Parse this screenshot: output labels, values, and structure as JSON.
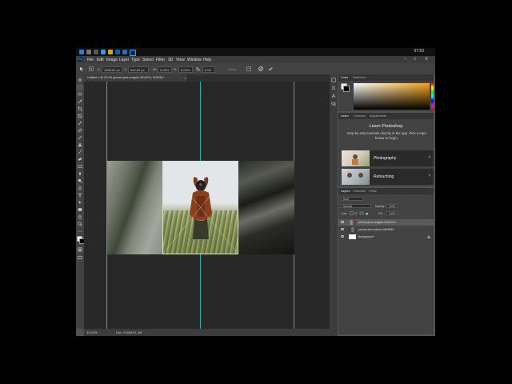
{
  "taskbar": {
    "time": "07:53"
  },
  "app": {
    "logo": "Ps"
  },
  "menu": [
    "File",
    "Edit",
    "Image",
    "Layer",
    "Type",
    "Select",
    "Filter",
    "3D",
    "View",
    "Window",
    "Help"
  ],
  "window_controls": {
    "minimize": "–",
    "maximize": "□",
    "close": "✕"
  },
  "options": {
    "x_value": "1055,00 px",
    "y_value": "540,00 px",
    "w_value": "0,00%",
    "h_value": "0,00%",
    "angle_value": "0,00",
    "x_label": "X:",
    "y_label": "Y:",
    "w_label": "W:",
    "h_label": "H:",
    "interp_label": "Interp"
  },
  "document_tab": {
    "title": "Untitled-1 @ 33,3% (pexels-jack-redgate-3014019, RGB/8) *",
    "close": "×"
  },
  "status": {
    "zoom": "33,33%",
    "doc": "Doc: 5,93M/11,1M"
  },
  "color_panel": {
    "tabs": [
      "Color",
      "Swatches"
    ],
    "accent": "#f5a21a"
  },
  "learn_panel": {
    "tabs": [
      "Learn",
      "Libraries",
      "Adjustments"
    ],
    "title": "Learn Photoshop",
    "subtitle": "Step-by-step tutorials directly in the app. Pick a topic below to begin.",
    "cards": [
      {
        "label": "Photography",
        "chevron": "›"
      },
      {
        "label": "Retouching",
        "chevron": "›"
      }
    ]
  },
  "layers_panel": {
    "tabs": [
      "Layers",
      "Channels",
      "Paths"
    ],
    "kind_label": "Kind",
    "blend_mode": "Normal",
    "opacity_label": "Opacity:",
    "opacity": "100%",
    "lock_label": "Lock:",
    "fill_label": "Fill:",
    "fill": "100%",
    "layers": [
      {
        "name": "pexels-jack-redgate-3014019",
        "selected": true
      },
      {
        "name": "pexels-karl-solano-2883859",
        "selected": false
      },
      {
        "name": "Background",
        "selected": false
      }
    ]
  }
}
